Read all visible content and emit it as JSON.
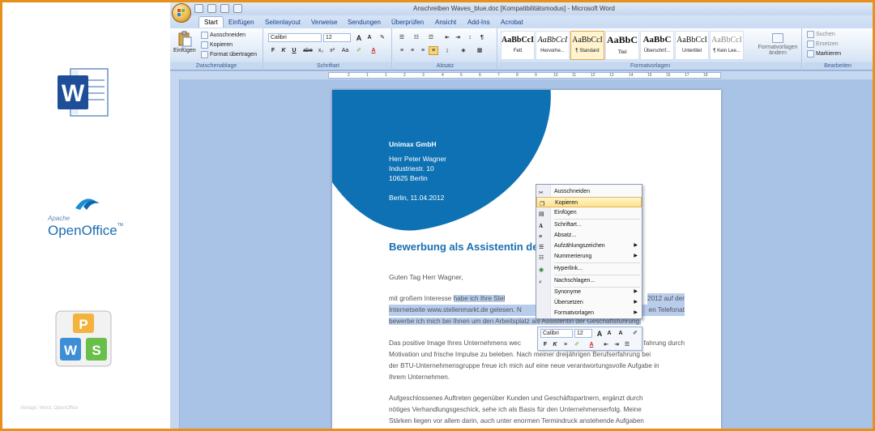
{
  "logos": {
    "word": "word-logo",
    "openoffice_brand": "Apache",
    "openoffice_name": "OpenOffice",
    "openoffice_tm": "TM",
    "wps": "wps-logo",
    "footer": "Vorlage: Word, OpenOffice"
  },
  "window": {
    "title": "Anschreiben Waves_blue.doc [Kompatibilitätsmodus] - Microsoft Word"
  },
  "tabs": [
    "Start",
    "Einfügen",
    "Seitenlayout",
    "Verweise",
    "Sendungen",
    "Überprüfen",
    "Ansicht",
    "Add-Ins",
    "Acrobat"
  ],
  "ribbon": {
    "clipboard": {
      "label": "Zwischenablage",
      "paste": "Einfügen",
      "cut": "Ausschneiden",
      "copy": "Kopieren",
      "format": "Format übertragen"
    },
    "font": {
      "label": "Schriftart",
      "font_name": "Calibri",
      "font_size": "12",
      "bold": "F",
      "italic": "K",
      "underline": "U",
      "strike": "abe",
      "sub": "x₂",
      "sup": "x²",
      "case": "Aa",
      "grow": "A",
      "shrink": "A"
    },
    "paragraph": {
      "label": "Absatz"
    },
    "styles": {
      "label": "Formatvorlagen",
      "items": [
        {
          "preview": "AaBbCcI",
          "name": "Fett"
        },
        {
          "preview": "AaBbCcI",
          "name": "Hervorhe..."
        },
        {
          "preview": "AaBbCcI",
          "name": "¶ Standard"
        },
        {
          "preview": "AaBbC",
          "name": "Titel"
        },
        {
          "preview": "AaBbC",
          "name": "Überschrif..."
        },
        {
          "preview": "AaBbCcI",
          "name": "Untertitel"
        },
        {
          "preview": "AaBbCcI",
          "name": "¶ Kein Lee..."
        }
      ],
      "change_styles": "Formatvorlagen ändern"
    },
    "editing": {
      "label": "Bearbeiten",
      "find": "Suchen",
      "replace": "Ersetzen",
      "select": "Markieren"
    }
  },
  "ruler_marks": [
    "2",
    "1",
    "1",
    "2",
    "3",
    "4",
    "5",
    "6",
    "7",
    "8",
    "9",
    "10",
    "11",
    "12",
    "13",
    "14",
    "15",
    "16",
    "17",
    "18"
  ],
  "document": {
    "company": "Unimax GmbH",
    "recipient": "Herr Peter Wagner",
    "street": "Industriestr. 10",
    "city": "10625 Berlin",
    "date": "Berlin, 11.04.2012",
    "subject": "Bewerbung als Assistentin der",
    "greeting": "Guten Tag Herr Wagner,",
    "p1_l1a": "mit großem Interesse ",
    "p1_l1b": "habe ich Ihre Stel",
    "p1_l1c": "2012 auf der",
    "p1_l2a": "Internetseite www.stellenmarkt.de gelesen. N",
    "p1_l2b": "en Telefonat",
    "p1_l3": "bewerbe ich mich bei Ihnen um den Arbeitsplatz als Assistentin der Geschäftsführung.",
    "p2_l1a": "Das positive Image Ihres Unternehmens wec",
    "p2_l1b": "fahrung durch",
    "p2_l2": "Motivation und frische Impulse zu beleben. Nach meiner dreijährigen Berufserfahrung bei",
    "p2_l3": "der BTU-Unternehmensgruppe freue ich mich auf eine neue verantwortungsvolle Aufgabe in",
    "p2_l4": "Ihrem Unternehmen.",
    "p3_l1": "Aufgeschlossenes Auftreten gegenüber Kunden und Geschäftspartnern, ergänzt durch",
    "p3_l2": "nötiges Verhandlungsgeschick, sehe ich als Basis für den Unternehmenserfolg. Meine",
    "p3_l3": "Stärken liegen vor allem darin, auch unter enormen Termindruck anstehende Aufgaben"
  },
  "context_menu": {
    "items": [
      {
        "label": "Ausschneiden",
        "icon": "scissors-icon"
      },
      {
        "label": "Kopieren",
        "icon": "copy-icon"
      },
      {
        "label": "Einfügen",
        "icon": "paste-icon"
      },
      {
        "label": "Schriftart...",
        "icon": "font-icon"
      },
      {
        "label": "Absatz...",
        "icon": "paragraph-icon"
      },
      {
        "label": "Aufzählungszeichen",
        "icon": "bullets-icon"
      },
      {
        "label": "Nummerierung",
        "icon": "numbering-icon"
      },
      {
        "label": "Hyperlink...",
        "icon": "hyperlink-icon"
      },
      {
        "label": "Nachschlagen...",
        "icon": "lookup-icon"
      },
      {
        "label": "Synonyme",
        "icon": ""
      },
      {
        "label": "Übersetzen",
        "icon": ""
      },
      {
        "label": "Formatvorlagen",
        "icon": ""
      }
    ]
  },
  "mini_toolbar": {
    "font_name": "Calibri",
    "font_size": "12",
    "bold": "F",
    "italic": "K",
    "align": "≡"
  },
  "colors": {
    "frame": "#e8901c",
    "wave": "#0d71b4",
    "subject": "#1a6fb0",
    "selection": "#b8ccec"
  }
}
